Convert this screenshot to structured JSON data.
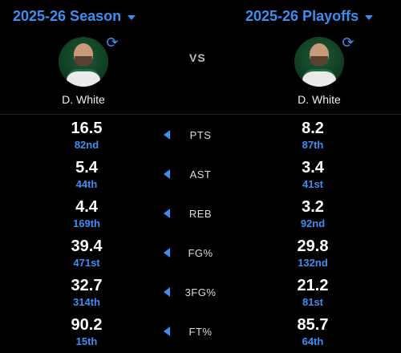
{
  "header": {
    "left_season": "2025-26 Season",
    "right_season": "2025-26 Playoffs",
    "vs": "VS",
    "left_player": {
      "name": "D. White",
      "avatar": "player-photo",
      "icon": "refresh-icon"
    },
    "right_player": {
      "name": "D. White",
      "avatar": "player-photo",
      "icon": "refresh-icon"
    }
  },
  "accent_color": "#3d8ef0",
  "stats": [
    {
      "label": "PTS",
      "left_value": "16.5",
      "left_rank": "82nd",
      "right_value": "8.2",
      "right_rank": "87th"
    },
    {
      "label": "AST",
      "left_value": "5.4",
      "left_rank": "44th",
      "right_value": "3.4",
      "right_rank": "41st"
    },
    {
      "label": "REB",
      "left_value": "4.4",
      "left_rank": "169th",
      "right_value": "3.2",
      "right_rank": "92nd"
    },
    {
      "label": "FG%",
      "left_value": "39.4",
      "left_rank": "471st",
      "right_value": "29.8",
      "right_rank": "132nd"
    },
    {
      "label": "3FG%",
      "left_value": "32.7",
      "left_rank": "314th",
      "right_value": "21.2",
      "right_rank": "81st"
    },
    {
      "label": "FT%",
      "left_value": "90.2",
      "left_rank": "15th",
      "right_value": "85.7",
      "right_rank": "64th"
    }
  ]
}
